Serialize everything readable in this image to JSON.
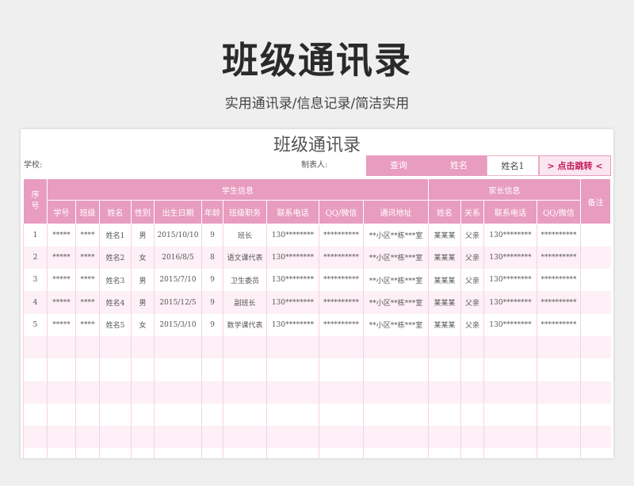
{
  "header": {
    "title": "班级通讯录",
    "subtitle": "实用通讯录/信息记录/简洁实用"
  },
  "sheet": {
    "title": "班级通讯录",
    "school_label": "学校:",
    "maker_label": "制表人:",
    "query_button": "查询",
    "name_label": "姓名",
    "name_input": "姓名1",
    "jump_button": "> 点击跳转 <"
  },
  "table": {
    "index_header": "序\n号",
    "group_student": "学生信息",
    "group_parent": "家长信息",
    "remark_header": "备注",
    "columns": [
      "学号",
      "班级",
      "姓名",
      "性别",
      "出生日期",
      "年龄",
      "班级职务",
      "联系电话",
      "QQ/微信",
      "通讯地址",
      "姓名",
      "关系",
      "联系电话",
      "QQ/微信"
    ],
    "rows": [
      [
        "1",
        "*****",
        "****",
        "姓名1",
        "男",
        "2015/10/10",
        "9",
        "班长",
        "130********",
        "**********",
        "**小区**栋***室",
        "某某某",
        "父亲",
        "130********",
        "**********",
        ""
      ],
      [
        "2",
        "*****",
        "****",
        "姓名2",
        "女",
        "2016/8/5",
        "8",
        "语文课代表",
        "130********",
        "**********",
        "**小区**栋***室",
        "某某某",
        "父亲",
        "130********",
        "**********",
        ""
      ],
      [
        "3",
        "*****",
        "****",
        "姓名3",
        "男",
        "2015/7/10",
        "9",
        "卫生委员",
        "130********",
        "**********",
        "**小区**栋***室",
        "某某某",
        "父亲",
        "130********",
        "**********",
        ""
      ],
      [
        "4",
        "*****",
        "****",
        "姓名4",
        "男",
        "2015/12/5",
        "9",
        "副班长",
        "130********",
        "**********",
        "**小区**栋***室",
        "某某某",
        "父亲",
        "130********",
        "**********",
        ""
      ],
      [
        "5",
        "*****",
        "****",
        "姓名5",
        "女",
        "2015/3/10",
        "9",
        "数学课代表",
        "130********",
        "**********",
        "**小区**栋***室",
        "某某某",
        "父亲",
        "130********",
        "**********",
        ""
      ]
    ],
    "empty_rows": 6
  },
  "colors": {
    "accent": "#e89cc0",
    "row_alt": "#fdf0f6",
    "jump_text": "#c2185b"
  }
}
